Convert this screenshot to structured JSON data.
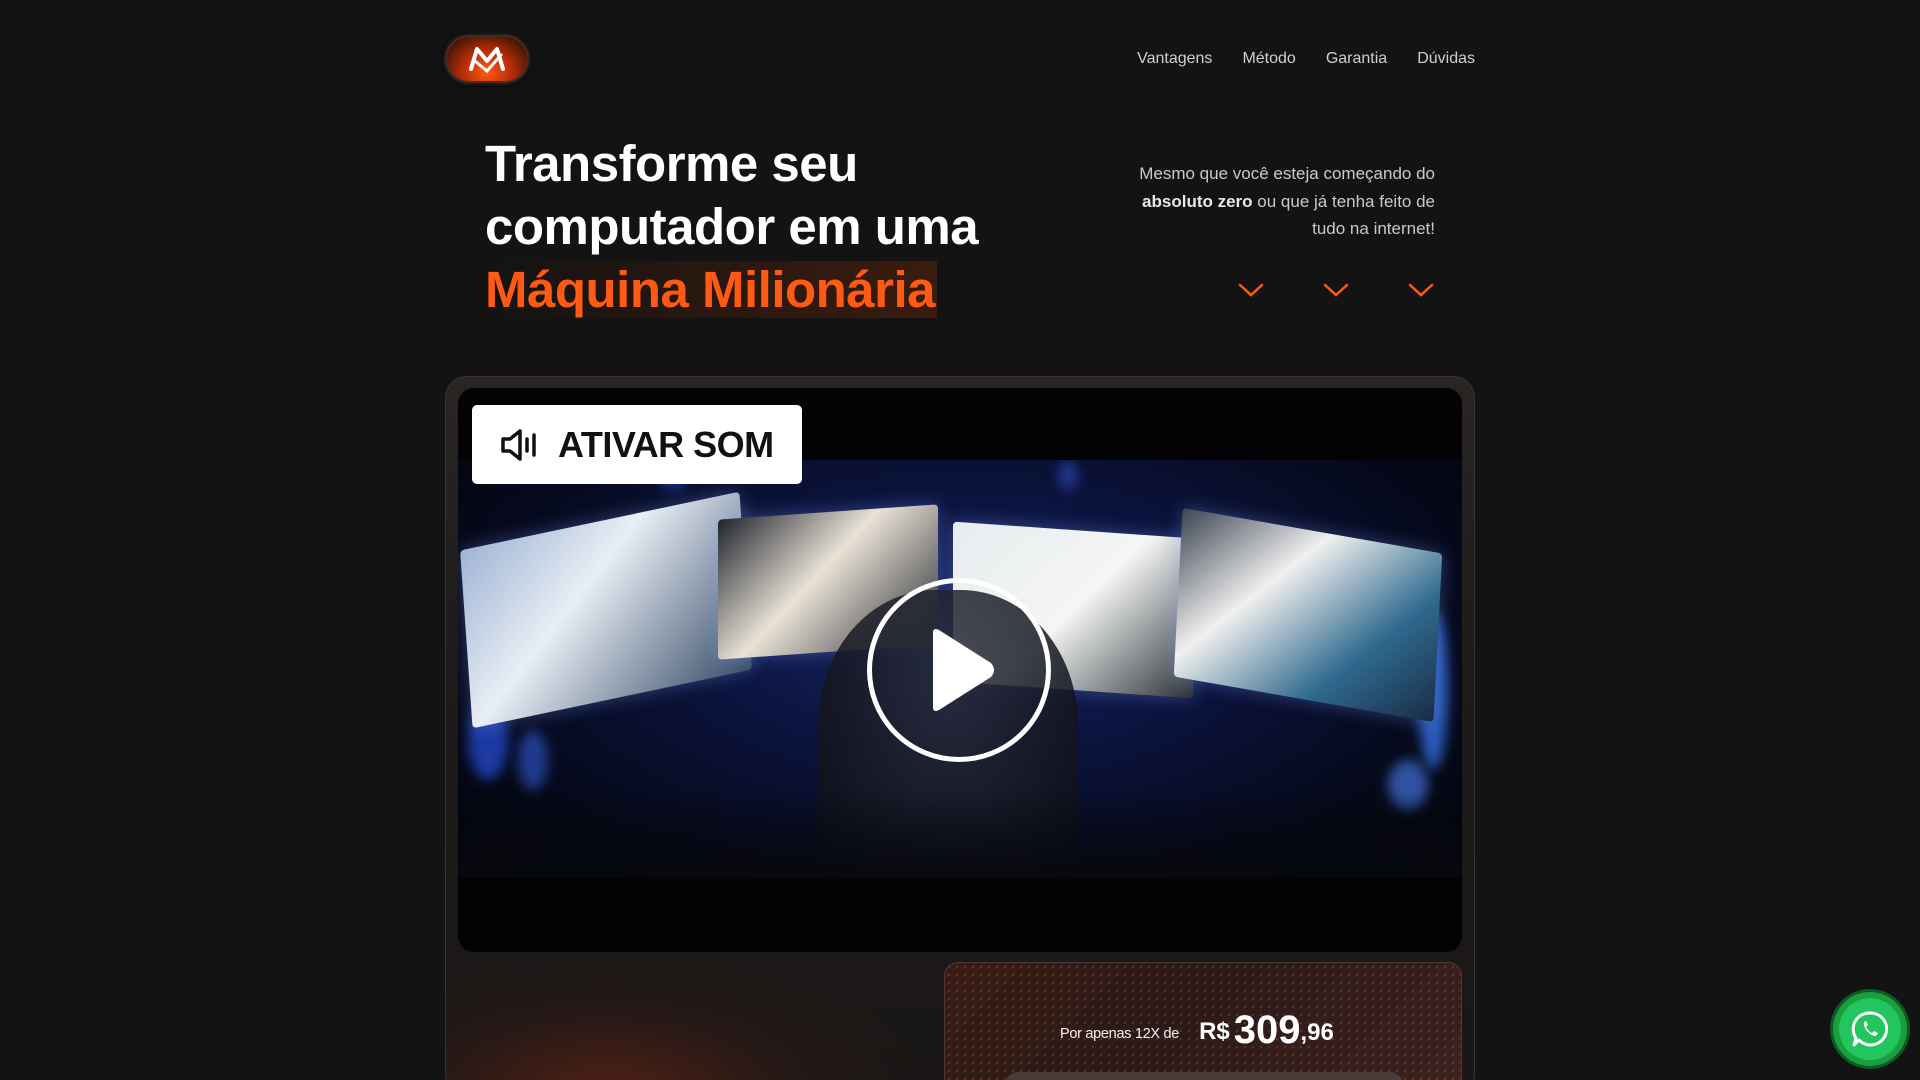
{
  "header": {
    "logo_icon": "m-logo-icon",
    "nav": [
      "Vantagens",
      "Método",
      "Garantia",
      "Dúvidas"
    ]
  },
  "hero": {
    "title_line1": "Transforme seu",
    "title_line2": "computador em uma",
    "title_accent": "Máquina Milionária",
    "subtitle_pre": "Mesmo que você esteja começando do",
    "subtitle_bold": "absoluto zero",
    "subtitle_post": "ou que já tenha feito de tudo na internet!",
    "chevron_icon": "chevron-down-icon"
  },
  "video": {
    "sound_button_label": "ATIVAR SOM",
    "sound_icon": "speaker-icon",
    "play_icon": "play-icon"
  },
  "offer": {
    "price_label": "Por apenas 12X de",
    "currency": "R$",
    "price_integer": "309",
    "price_decimal": ",96"
  },
  "floating": {
    "whatsapp_icon": "whatsapp-icon"
  },
  "colors": {
    "accent": "#ff5a14",
    "background": "#131313",
    "whatsapp": "#22c55e"
  }
}
